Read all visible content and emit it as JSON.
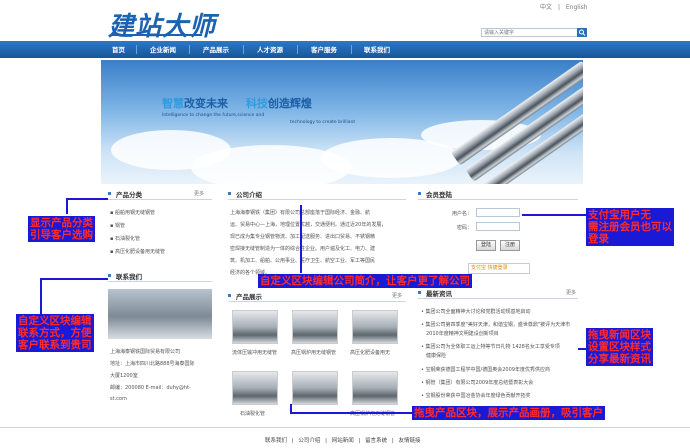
{
  "header": {
    "logo_text": "建站大师",
    "lang_zh": "中文",
    "lang_sep": "|",
    "lang_en": "English",
    "search_placeholder": "请输入关键字"
  },
  "nav": [
    "首页",
    "企业新闻",
    "产品展示",
    "人才资源",
    "客户服务",
    "联系我们"
  ],
  "banner": {
    "slogan_a": "智慧",
    "slogan_b": "改变未来",
    "slogan_c": "科技",
    "slogan_d": "创造辉煌",
    "slogan_en_1": "Intelligence to change the future,science and",
    "slogan_en_2": "technology to create brilliant"
  },
  "product_category": {
    "title": "产品分类",
    "more": "更多",
    "items": [
      "船舶用钢无缝钢管",
      "锅管",
      "石油裂化管",
      "高压化肥设备用无缝管"
    ]
  },
  "contact": {
    "title": "联系我们",
    "lines": [
      "上海海泰钢铁国际贸易有限公司",
      "地址：上海市四川北路888号海泰国际",
      "大厦1200室",
      "邮编：200080 E-mail：duhy@ht-",
      "st.com"
    ]
  },
  "company_intro": {
    "title": "公司介绍",
    "text_lines": [
      "上海海泰钢铁（集团）有限公司总部座落于国际经济、金融、航",
      "运、贸易中心—上海，地理位置优越，交通便利。通过近20年的发展，",
      "现已成为集专业钢管物流、加工配送服务、进出口贸易、不锈钢精",
      "密焊接无缝管制造为一体的综合性企业。用户遍及化工、电力、建",
      "筑、机加工、船舶、公用事业、医疗卫生、航空工业、军工等国民",
      "经济的各个领域。"
    ]
  },
  "product_show": {
    "title": "产品展示",
    "more": "更多",
    "items": [
      "流体压输冲用无缝管",
      "高压锅炉用无缝钢管",
      "高压化肥设备用无",
      "石油裂化管",
      "",
      "高压锅炉用无缝钢管"
    ]
  },
  "member_login": {
    "title": "会员登陆",
    "user_label": "用户名：",
    "pass_label": "密码：",
    "login_btn": "登陆",
    "register_btn": "注册",
    "alipay_text": "支付宝 快捷登录"
  },
  "news": {
    "title": "最新资讯",
    "more": "更多",
    "items": [
      "集团公司全面精神大讨论和党群活动规基地启动",
      "集团公司第四季度\"美好天津，和谐宝钢，盛世尊鼎\"被评为天津市",
      "2010年度精神文明建设创新项目",
      "集团公司为全体职工运上特等节日礼物 1428名女工享受专项",
      "健康保险",
      "宝钢荣获德国工程学中国/德国奥会2009年度优秀供应商",
      "钢管（集团）有限公司2009年度总结暨表彰大会",
      "宝钢股份荣获中国冶金协会年度绿色贡献开拓奖"
    ]
  },
  "annotations": {
    "a1_l1": "显示产品分类",
    "a1_l2": "引导客户选购",
    "a2": "自定义区块编辑公司简介，让客户更了解公司",
    "a3_l1": "支付宝用户无",
    "a3_l2": "需注册会员也可以",
    "a3_l3": "登录",
    "a4_l1": "自定义区块编辑",
    "a4_l2": "联系方式，方便",
    "a4_l3": "客户联系到贵司",
    "a5_l1": "拖曳新闻区块",
    "a5_l2": "设置区块样式",
    "a5_l3": "分享最新资讯",
    "a6": "拖曳产品区块，展示产品画册，吸引客户"
  },
  "footer": {
    "links": [
      "联系我们",
      "公司介绍",
      "网站新闻",
      "留言系统",
      "友情链接"
    ],
    "sep": "|"
  },
  "colors": {
    "brand_blue": "#1d62b0",
    "nav_blue": "#15569b",
    "annotation_bg": "#1a1ad6",
    "annotation_text": "#ff2a2a"
  }
}
